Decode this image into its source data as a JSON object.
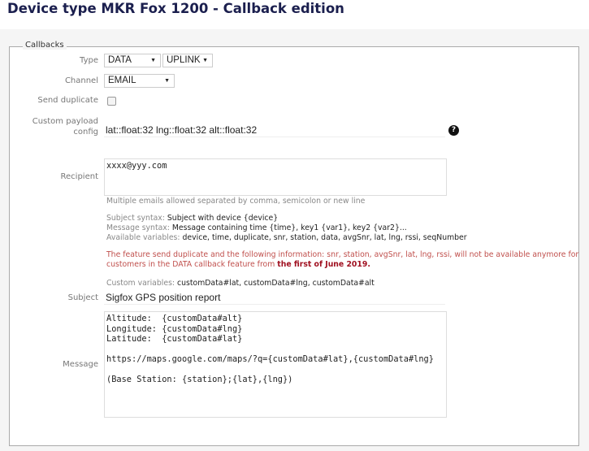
{
  "page_title": "Device type MKR Fox 1200 - Callback edition",
  "fieldset_legend": "Callbacks",
  "type": {
    "label": "Type",
    "value1": "DATA",
    "value2": "UPLINK"
  },
  "channel": {
    "label": "Channel",
    "value": "EMAIL"
  },
  "send_duplicate": {
    "label": "Send duplicate",
    "checked": false
  },
  "custom_payload": {
    "label_line1": "Custom payload",
    "label_line2": "config",
    "value": "lat::float:32 lng::float:32 alt::float:32",
    "help_icon": "?"
  },
  "recipient": {
    "label": "Recipient",
    "value": "xxxx@yyy.com",
    "hint": "Multiple emails allowed separated by comma, semicolon or new line"
  },
  "syntax": {
    "subject_label": "Subject syntax:",
    "subject_value": "Subject with device {device}",
    "message_label": "Message syntax:",
    "message_value": "Message containing time {time}, key1 {var1}, key2 {var2}...",
    "vars_label": "Available variables:",
    "vars_value": "device, time, duplicate, snr, station, data, avgSnr, lat, lng, rssi, seqNumber"
  },
  "warning": {
    "line1": "The feature send duplicate and the following information: snr, station, avgSnr, lat, lng, rssi, will not be available anymore for",
    "line2": "customers in the DATA callback feature from ",
    "date": "the first of June 2019."
  },
  "custom_vars": {
    "label": "Custom variables:",
    "value": "customData#lat, customData#lng, customData#alt"
  },
  "subject": {
    "label": "Subject",
    "value": "Sigfox GPS position report"
  },
  "message": {
    "label": "Message",
    "value": "Altitude:  {customData#alt}\nLongitude: {customData#lng}\nLatitude:  {customData#lat}\n\nhttps://maps.google.com/maps/?q={customData#lat},{customData#lng}\n\n(Base Station: {station};{lat},{lng})"
  }
}
